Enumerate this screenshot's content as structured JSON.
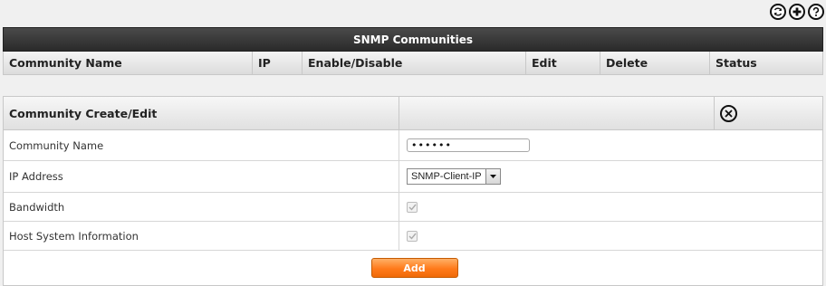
{
  "toolbar": {
    "icons": [
      "refresh-icon",
      "add-icon",
      "help-icon"
    ]
  },
  "communities": {
    "title": "SNMP Communities",
    "columns": [
      "Community Name",
      "IP",
      "Enable/Disable",
      "Edit",
      "Delete",
      "Status"
    ]
  },
  "form": {
    "title": "Community Create/Edit",
    "fields": {
      "community_name": {
        "label": "Community Name",
        "value": "••••••"
      },
      "ip_address": {
        "label": "IP Address",
        "value": "SNMP-Client-IP"
      },
      "bandwidth": {
        "label": "Bandwidth",
        "checked": true
      },
      "host_system_information": {
        "label": "Host System Information",
        "checked": true
      }
    },
    "add_label": "Add"
  },
  "colors": {
    "header_dark": "#2a2a2a",
    "accent_orange": "#ff7a1a"
  }
}
